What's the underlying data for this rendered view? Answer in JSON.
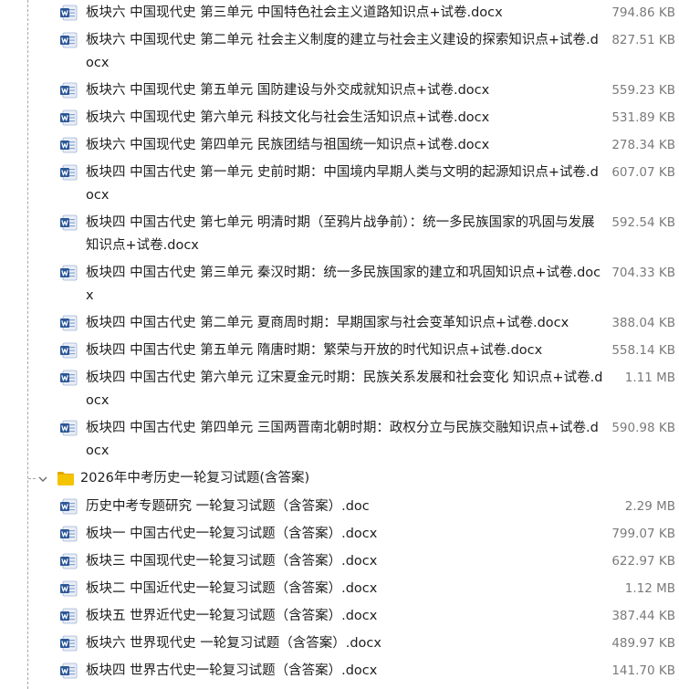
{
  "files_top": [
    {
      "name": "板块六 中国现代史 第三单元 中国特色社会主义道路知识点+试卷.docx",
      "size": "794.86 KB"
    },
    {
      "name": "板块六 中国现代史 第二单元 社会主义制度的建立与社会主义建设的探索知识点+试卷.docx",
      "size": "827.51 KB"
    },
    {
      "name": "板块六 中国现代史 第五单元 国防建设与外交成就知识点+试卷.docx",
      "size": "559.23 KB"
    },
    {
      "name": "板块六 中国现代史 第六单元 科技文化与社会生活知识点+试卷.docx",
      "size": "531.89 KB"
    },
    {
      "name": "板块六 中国现代史 第四单元 民族团结与祖国统一知识点+试卷.docx",
      "size": "278.34 KB"
    },
    {
      "name": "板块四 中国古代史 第一单元 史前时期：中国境内早期人类与文明的起源知识点+试卷.docx",
      "size": "607.07 KB"
    },
    {
      "name": "板块四 中国古代史 第七单元 明清时期（至鸦片战争前）：统一多民族国家的巩固与发展知识点+试卷.docx",
      "size": "592.54 KB"
    },
    {
      "name": "板块四 中国古代史 第三单元 秦汉时期：统一多民族国家的建立和巩固知识点+试卷.docx",
      "size": "704.33 KB"
    },
    {
      "name": "板块四 中国古代史 第二单元 夏商周时期：早期国家与社会变革知识点+试卷.docx",
      "size": "388.04 KB"
    },
    {
      "name": "板块四 中国古代史 第五单元 隋唐时期：繁荣与开放的时代知识点+试卷.docx",
      "size": "558.14 KB"
    },
    {
      "name": "板块四 中国古代史 第六单元 辽宋夏金元时期：民族关系发展和社会变化 知识点+试卷.docx",
      "size": "1.11 MB"
    },
    {
      "name": "板块四 中国古代史 第四单元 三国两晋南北朝时期：政权分立与民族交融知识点+试卷.docx",
      "size": "590.98 KB"
    }
  ],
  "folder": {
    "name": "2026年中考历史一轮复习试题(含答案)",
    "icon": "folder-icon",
    "color": "#f5c400"
  },
  "files_bottom": [
    {
      "name": "历史中考专题研究 一轮复习试题（含答案）.doc",
      "size": "2.29 MB"
    },
    {
      "name": "板块一 中国古代史一轮复习试题（含答案）.docx",
      "size": "799.07 KB"
    },
    {
      "name": "板块三 中国现代史一轮复习试题（含答案）.docx",
      "size": "622.97 KB"
    },
    {
      "name": "板块二 中国近代史一轮复习试题（含答案）.docx",
      "size": "1.12 MB"
    },
    {
      "name": "板块五 世界近代史一轮复习试题（含答案）.docx",
      "size": "387.44 KB"
    },
    {
      "name": "板块六 世界现代史 一轮复习试题（含答案）.docx",
      "size": "489.97 KB"
    },
    {
      "name": "板块四 世界古代史一轮复习试题（含答案）.docx",
      "size": "141.70 KB"
    }
  ],
  "icons": {
    "file": "word-document-icon",
    "chevron": "chevron-down-icon",
    "file_color": "#2b5797"
  }
}
